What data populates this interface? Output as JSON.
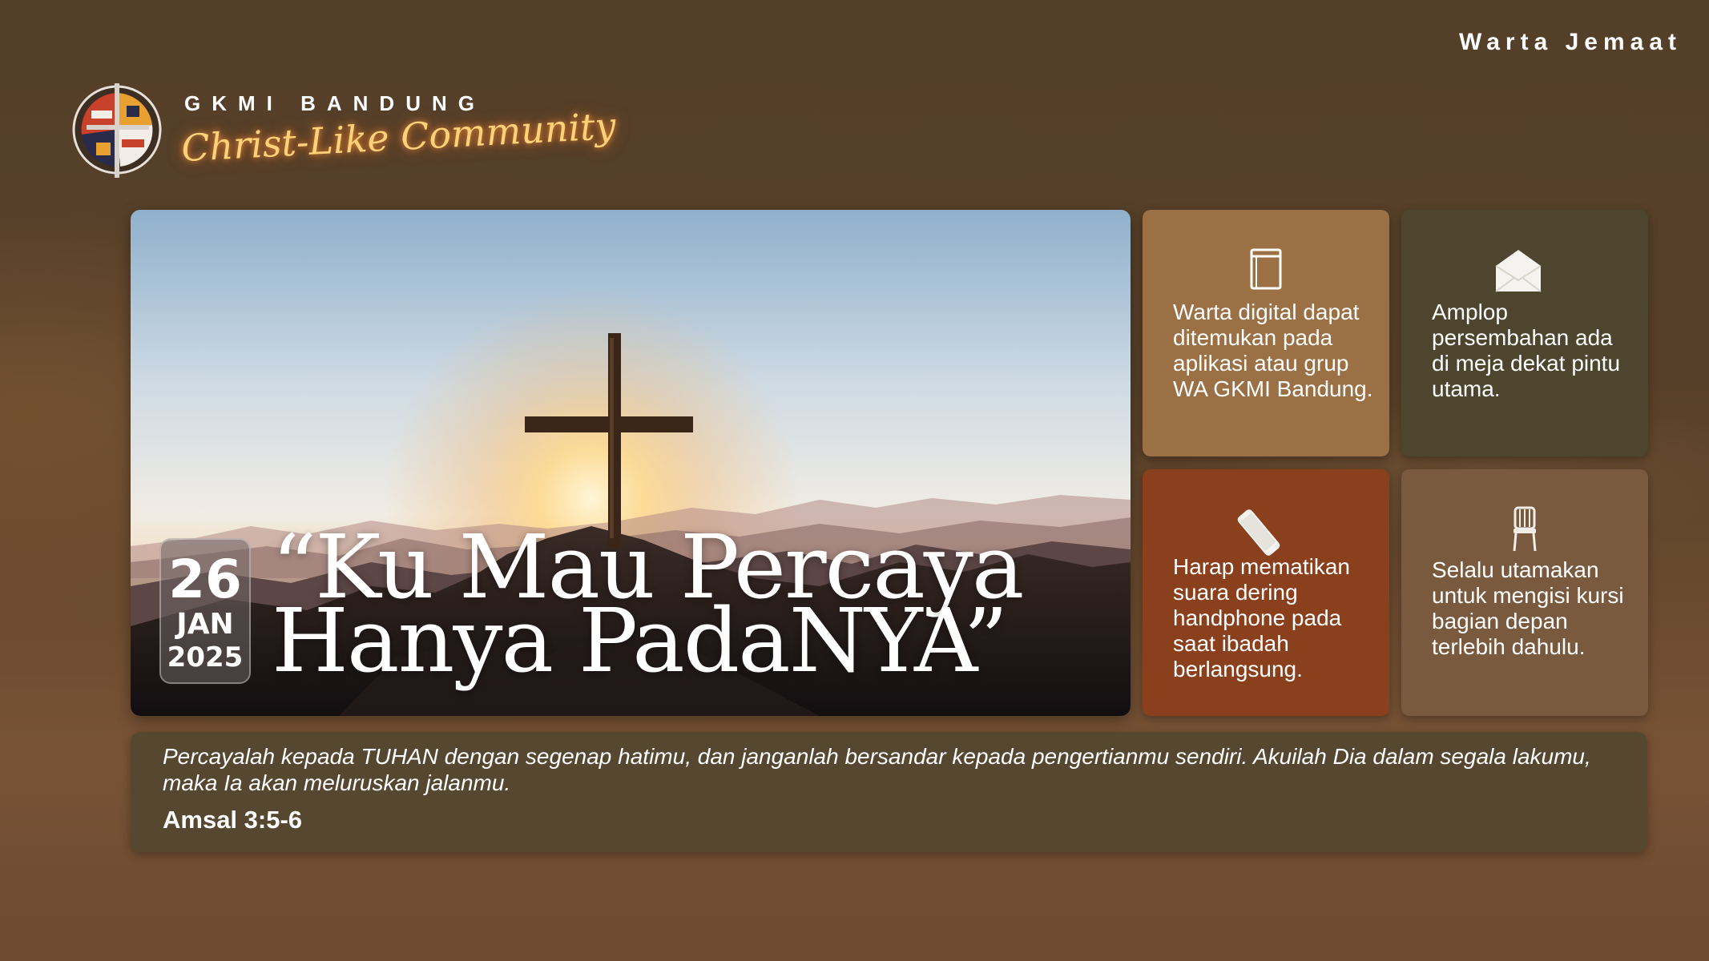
{
  "header": {
    "title": "Warta Jemaat"
  },
  "logo": {
    "church_name": "GKMI BANDUNG",
    "tagline": "Christ-Like Community"
  },
  "hero": {
    "date": {
      "day": "26",
      "month": "JAN",
      "year": "2025"
    },
    "title_line_1": "“Ku Mau Percaya",
    "title_line_2": "Hanya PadaNYA”"
  },
  "tiles": [
    {
      "icon": "book-icon",
      "text": "Warta digital dapat ditemukan pada aplikasi atau grup WA GKMI Bandung.",
      "color": "#9a7044"
    },
    {
      "icon": "envelope-icon",
      "text": "Amplop persembahan ada di meja dekat pintu utama.",
      "color": "#4e452f"
    },
    {
      "icon": "phone-icon",
      "text": "Harap mematikan suara dering handphone pada saat ibadah berlangsung.",
      "color": "#8a3f1d"
    },
    {
      "icon": "chair-icon",
      "text": "Selalu utamakan untuk mengisi kursi bagian depan terlebih dahulu.",
      "color": "#7a5a3e"
    }
  ],
  "verse": {
    "text": "Percayalah kepada TUHAN dengan segenap hatimu, dan janganlah bersandar kepada pengertianmu sendiri. Akuilah Dia dalam segala lakumu, maka Ia akan meluruskan jalanmu.",
    "reference": "Amsal 3:5-6"
  },
  "colors": {
    "background": "#54402a",
    "tagline_glow": "#ffd27a"
  }
}
